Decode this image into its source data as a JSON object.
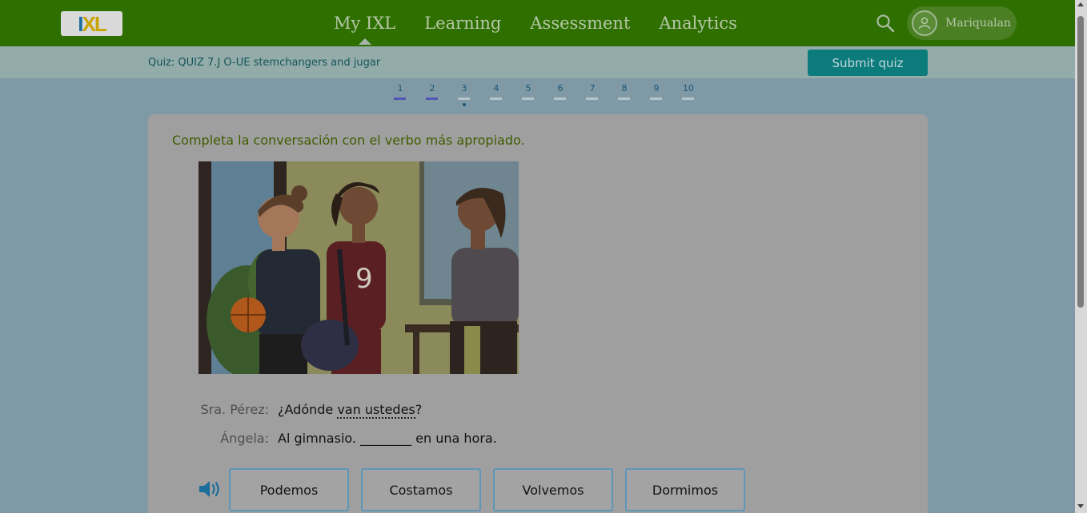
{
  "header": {
    "logo_text": "IXL",
    "nav": [
      "My IXL",
      "Learning",
      "Assessment",
      "Analytics"
    ],
    "active_nav": "My IXL",
    "username": "Mariqualan"
  },
  "quiz": {
    "title": "Quiz: QUIZ 7.J O-UE stemchangers and jugar",
    "submit_label": "Submit quiz",
    "pages": [
      "1",
      "2",
      "3",
      "4",
      "5",
      "6",
      "7",
      "8",
      "9",
      "10"
    ],
    "completed_pages": 2,
    "current_page": "3"
  },
  "question": {
    "prompt": "Completa la conversación con el verbo más apropiado.",
    "dialogue": [
      {
        "speaker": "Sra. Pérez:",
        "before": "¿Adónde ",
        "underlined": "van ustedes",
        "after": "?"
      },
      {
        "speaker": "Ángela:",
        "before": "Al gimnasio. ",
        "blank": "________",
        "after": " en una hora."
      }
    ],
    "choices": [
      "Podemos",
      "Costamos",
      "Volvemos",
      "Dormimos"
    ]
  },
  "colors": {
    "nav_bg": "#2e6f00",
    "submit_bg": "#0b7b7c",
    "prompt_text": "#3f5d00"
  }
}
